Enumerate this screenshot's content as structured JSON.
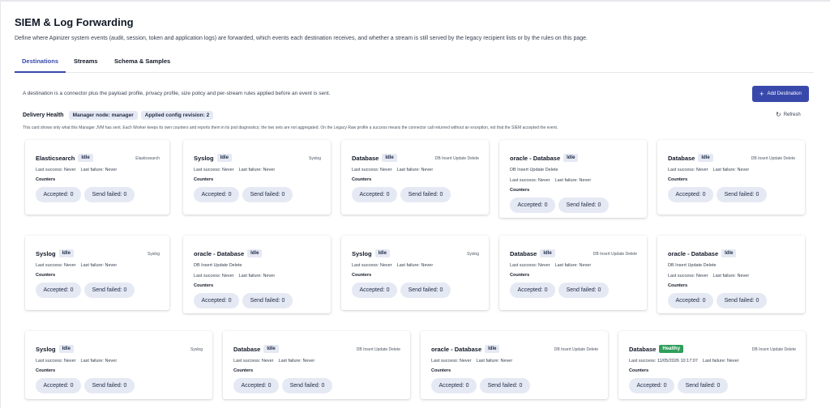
{
  "header": {
    "title": "SIEM & Log Forwarding",
    "description": "Define where Apinizer system events (audit, session, token and application logs) are forwarded, which events each destination receives, and whether a stream is still served by the legacy recipient lists or by the rules on this page."
  },
  "tabs": {
    "destinations": "Destinations",
    "streams": "Streams",
    "schema": "Schema & Samples"
  },
  "intro": "A destination is a connector plus the payload profile, privacy profile, size policy and per-stream rules applied before an event is sent.",
  "add_destination_label": "Add Destination",
  "health": {
    "title": "Delivery Health",
    "manager_node": "Manager node: manager",
    "config_revision": "Applied config revision: 2",
    "refresh_label": "Refresh",
    "note": "This card shows only what this Manager JVM has sent. Each Worker keeps its own counters and reports them in its pod diagnostics; the two sets are not aggregated. On the Legacy Raw profile a success means the connector call returned without an exception, not that the SIEM accepted the event."
  },
  "labels": {
    "last_success_prefix": "Last success:",
    "last_failure_prefix": "Last failure:",
    "counters": "Counters",
    "accepted_prefix": "Accepted:",
    "send_failed_prefix": "Send failed:"
  },
  "cards": [
    {
      "name": "Elasticsearch",
      "status": "Idle",
      "type": "Elasticsearch",
      "subtitle": "",
      "last_success": "Never",
      "last_failure": "Never",
      "accepted": 0,
      "send_failed": 0
    },
    {
      "name": "Syslog",
      "status": "Idle",
      "type": "Syslog",
      "subtitle": "",
      "last_success": "Never",
      "last_failure": "Never",
      "accepted": 0,
      "send_failed": 0
    },
    {
      "name": "Database",
      "status": "Idle",
      "type": "DB Insert Update Delete",
      "subtitle": "",
      "last_success": "Never",
      "last_failure": "Never",
      "accepted": 0,
      "send_failed": 0
    },
    {
      "name": "oracle - Database",
      "status": "Idle",
      "type": "",
      "subtitle": "DB Insert Update Delete",
      "last_success": "Never",
      "last_failure": "Never",
      "accepted": 0,
      "send_failed": 0
    },
    {
      "name": "Database",
      "status": "Idle",
      "type": "DB Insert Update Delete",
      "subtitle": "",
      "last_success": "Never",
      "last_failure": "Never",
      "accepted": 0,
      "send_failed": 0
    },
    {
      "name": "Syslog",
      "status": "Idle",
      "type": "Syslog",
      "subtitle": "",
      "last_success": "Never",
      "last_failure": "Never",
      "accepted": 0,
      "send_failed": 0
    },
    {
      "name": "oracle - Database",
      "status": "Idle",
      "type": "",
      "subtitle": "DB Insert Update Delete",
      "last_success": "Never",
      "last_failure": "Never",
      "accepted": 0,
      "send_failed": 0
    },
    {
      "name": "Syslog",
      "status": "Idle",
      "type": "Syslog",
      "subtitle": "",
      "last_success": "Never",
      "last_failure": "Never",
      "accepted": 0,
      "send_failed": 0
    },
    {
      "name": "Database",
      "status": "Idle",
      "type": "DB Insert Update Delete",
      "subtitle": "",
      "last_success": "Never",
      "last_failure": "Never",
      "accepted": 0,
      "send_failed": 0
    },
    {
      "name": "oracle - Database",
      "status": "Idle",
      "type": "",
      "subtitle": "DB Insert Update Delete",
      "last_success": "Never",
      "last_failure": "Never",
      "accepted": 0,
      "send_failed": 0
    },
    {
      "name": "Syslog",
      "status": "Idle",
      "type": "Syslog",
      "subtitle": "",
      "last_success": "Never",
      "last_failure": "Never",
      "accepted": 0,
      "send_failed": 0
    },
    {
      "name": "Database",
      "status": "Idle",
      "type": "DB Insert Update Delete",
      "subtitle": "",
      "last_success": "Never",
      "last_failure": "Never",
      "accepted": 0,
      "send_failed": 0
    },
    {
      "name": "oracle - Database",
      "status": "Idle",
      "type": "DB Insert Update Delete",
      "subtitle": "",
      "last_success": "Never",
      "last_failure": "Never",
      "accepted": 0,
      "send_failed": 0
    },
    {
      "name": "Database",
      "status": "Healthy",
      "type": "DB Insert Update Delete",
      "subtitle": "",
      "last_success": "11/05/2026 10:17:07",
      "last_failure": "Never",
      "accepted": 0,
      "send_failed": 0
    }
  ],
  "colors": {
    "accent": "#3949ab",
    "healthy": "#2e9e5a",
    "pill": "#e5e9f4"
  }
}
